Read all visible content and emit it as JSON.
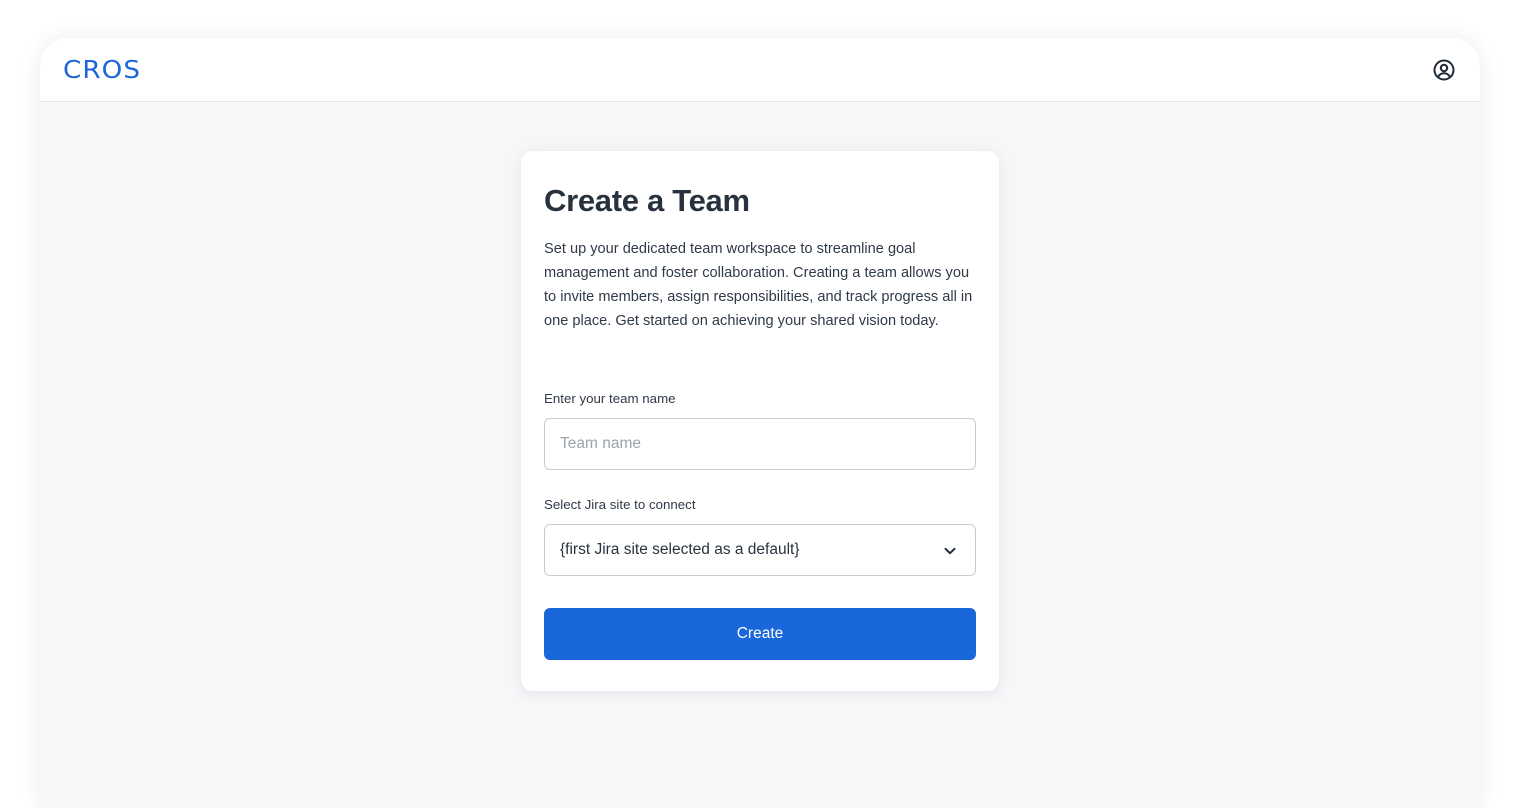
{
  "app": {
    "logo_text": "CROS",
    "brand_color": "#1c66d9"
  },
  "header": {
    "account_icon": "user-circle-icon"
  },
  "form": {
    "title": "Create a Team",
    "description": "Set up your dedicated team workspace to streamline goal management and foster collaboration. Creating a team allows you to invite members, assign responsibilities, and track progress all in one place. Get started on achieving your shared vision today.",
    "team_name_label": "Enter your team name",
    "team_name_placeholder": "Team name",
    "team_name_value": "",
    "jira_site_label": "Select Jira site to connect",
    "jira_site_selected": "{first Jira site selected as a default}",
    "dropdown_icon": "chevron-down-icon",
    "create_label": "Create",
    "button_color": "#1a66db"
  }
}
